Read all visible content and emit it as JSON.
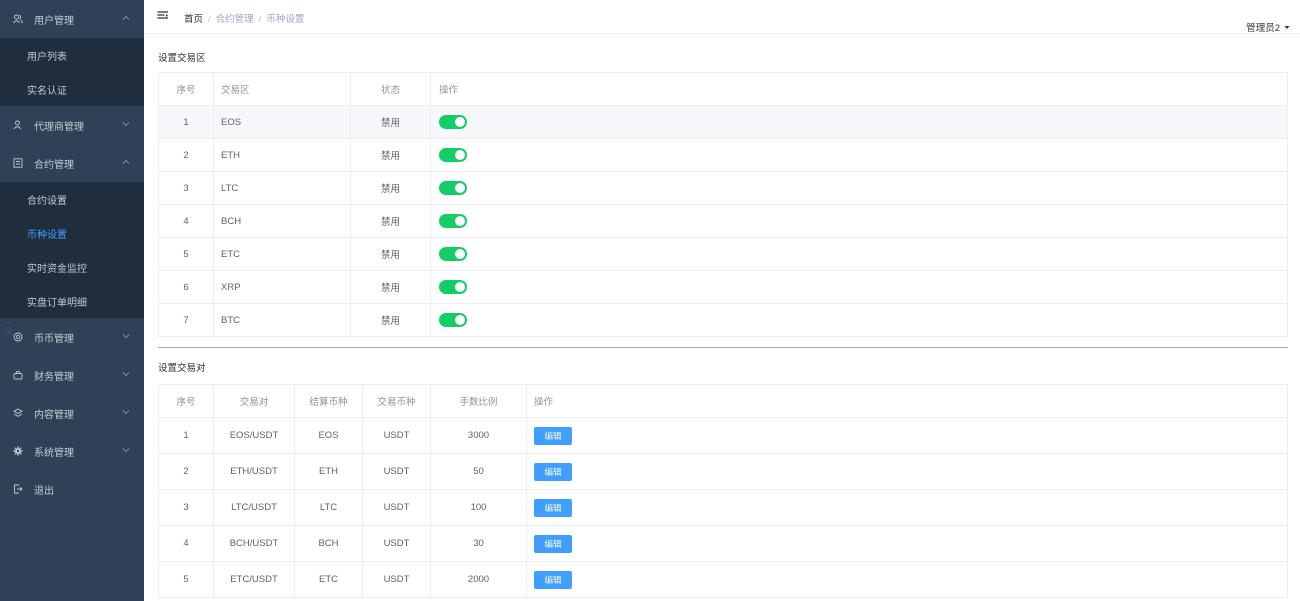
{
  "sidebar": {
    "menus": [
      {
        "label": "用户管理",
        "icon": "users-icon",
        "open": true,
        "children": [
          "用户列表",
          "实名认证"
        ]
      },
      {
        "label": "代理商管理",
        "icon": "agent-icon",
        "open": false
      },
      {
        "label": "合约管理",
        "icon": "contract-icon",
        "open": true,
        "children": [
          "合约设置",
          "币种设置",
          "实时资金监控",
          "实盘订单明细"
        ]
      },
      {
        "label": "币币管理",
        "icon": "coin-icon",
        "open": false
      },
      {
        "label": "财务管理",
        "icon": "finance-icon",
        "open": false
      },
      {
        "label": "内容管理",
        "icon": "content-icon",
        "open": false
      },
      {
        "label": "系统管理",
        "icon": "settings-icon",
        "open": false
      },
      {
        "label": "退出",
        "icon": "logout-icon",
        "open": false
      }
    ],
    "active_item": "币种设置"
  },
  "navbar": {
    "breadcrumb": [
      "首页",
      "合约管理",
      "币种设置"
    ],
    "user": "管理员2"
  },
  "zones": {
    "title": "设置交易区",
    "headers": [
      "序号",
      "交易区",
      "状态",
      "操作"
    ],
    "rows": [
      {
        "idx": "1",
        "zone": "EOS",
        "status": "禁用",
        "enabled": true
      },
      {
        "idx": "2",
        "zone": "ETH",
        "status": "禁用",
        "enabled": true
      },
      {
        "idx": "3",
        "zone": "LTC",
        "status": "禁用",
        "enabled": true
      },
      {
        "idx": "4",
        "zone": "BCH",
        "status": "禁用",
        "enabled": true
      },
      {
        "idx": "5",
        "zone": "ETC",
        "status": "禁用",
        "enabled": true
      },
      {
        "idx": "6",
        "zone": "XRP",
        "status": "禁用",
        "enabled": true
      },
      {
        "idx": "7",
        "zone": "BTC",
        "status": "禁用",
        "enabled": true
      }
    ]
  },
  "pairs": {
    "title": "设置交易对",
    "headers": [
      "序号",
      "交易对",
      "结算币种",
      "交易币种",
      "手数比例",
      "操作"
    ],
    "edit_label": "编辑",
    "rows": [
      {
        "idx": "1",
        "pair": "EOS/USDT",
        "settle": "EOS",
        "trade": "USDT",
        "ratio": "3000"
      },
      {
        "idx": "2",
        "pair": "ETH/USDT",
        "settle": "ETH",
        "trade": "USDT",
        "ratio": "50"
      },
      {
        "idx": "3",
        "pair": "LTC/USDT",
        "settle": "LTC",
        "trade": "USDT",
        "ratio": "100"
      },
      {
        "idx": "4",
        "pair": "BCH/USDT",
        "settle": "BCH",
        "trade": "USDT",
        "ratio": "30"
      },
      {
        "idx": "5",
        "pair": "ETC/USDT",
        "settle": "ETC",
        "trade": "USDT",
        "ratio": "2000"
      }
    ]
  },
  "colors": {
    "sidebar_bg": "#304156",
    "submenu_bg": "#1f2d3d",
    "active": "#409eff",
    "switch_on": "#13ce66",
    "button": "#409eff"
  }
}
